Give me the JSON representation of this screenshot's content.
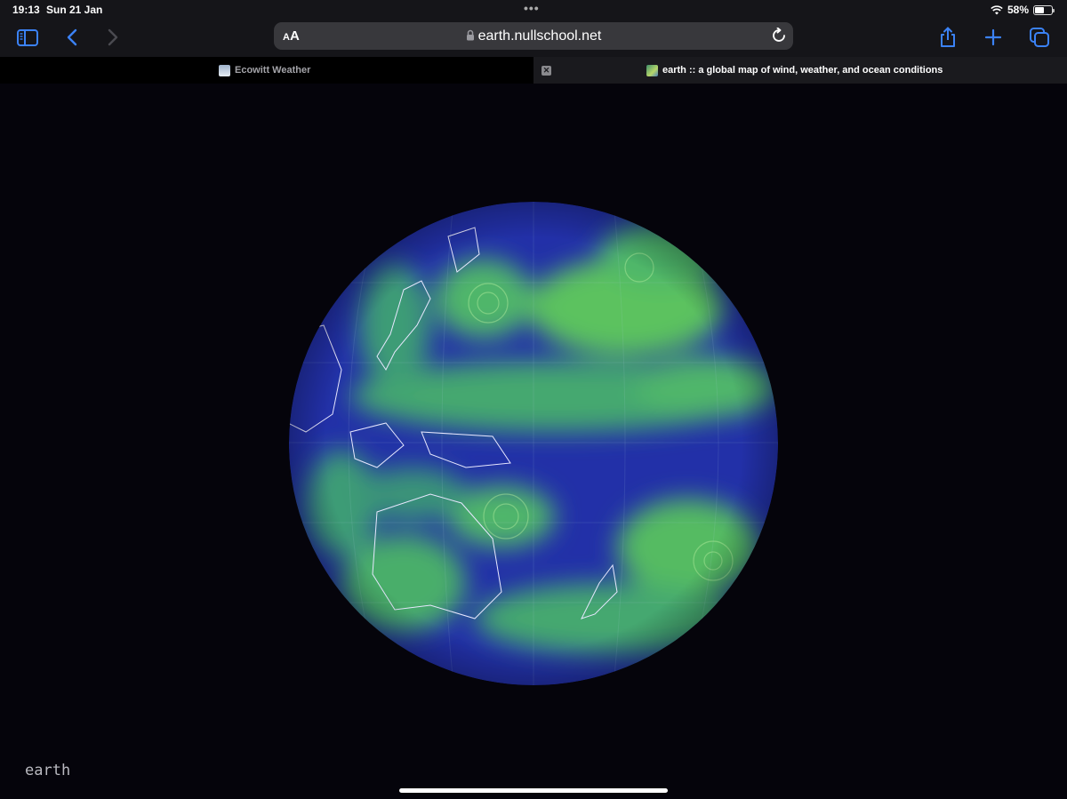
{
  "status_bar": {
    "time": "19:13",
    "date": "Sun 21 Jan",
    "battery_percent_label": "58%",
    "battery_level": 0.58,
    "icons": [
      "wifi-icon",
      "battery-icon"
    ]
  },
  "toolbar": {
    "text_size_label": "AA",
    "url": "earth.nullschool.net",
    "icons": [
      "sidebar-icon",
      "back-icon",
      "forward-icon",
      "lock-icon",
      "reload-icon",
      "share-icon",
      "new-tab-icon",
      "tabs-overview-icon"
    ],
    "accent_color": "#3b82f6"
  },
  "tabs": [
    {
      "title": "Ecowitt Weather",
      "active": false
    },
    {
      "title": "earth :: a global map of wind, weather, and ocean conditions",
      "active": true
    }
  ],
  "page": {
    "logo_text": "earth",
    "map": {
      "description": "orthographic globe of surface wind over the Pacific",
      "colors": {
        "calm": "#1b1fa3",
        "wind": "#5fc85a",
        "coastline": "#e8e8ff",
        "background": "#05040b"
      }
    }
  }
}
